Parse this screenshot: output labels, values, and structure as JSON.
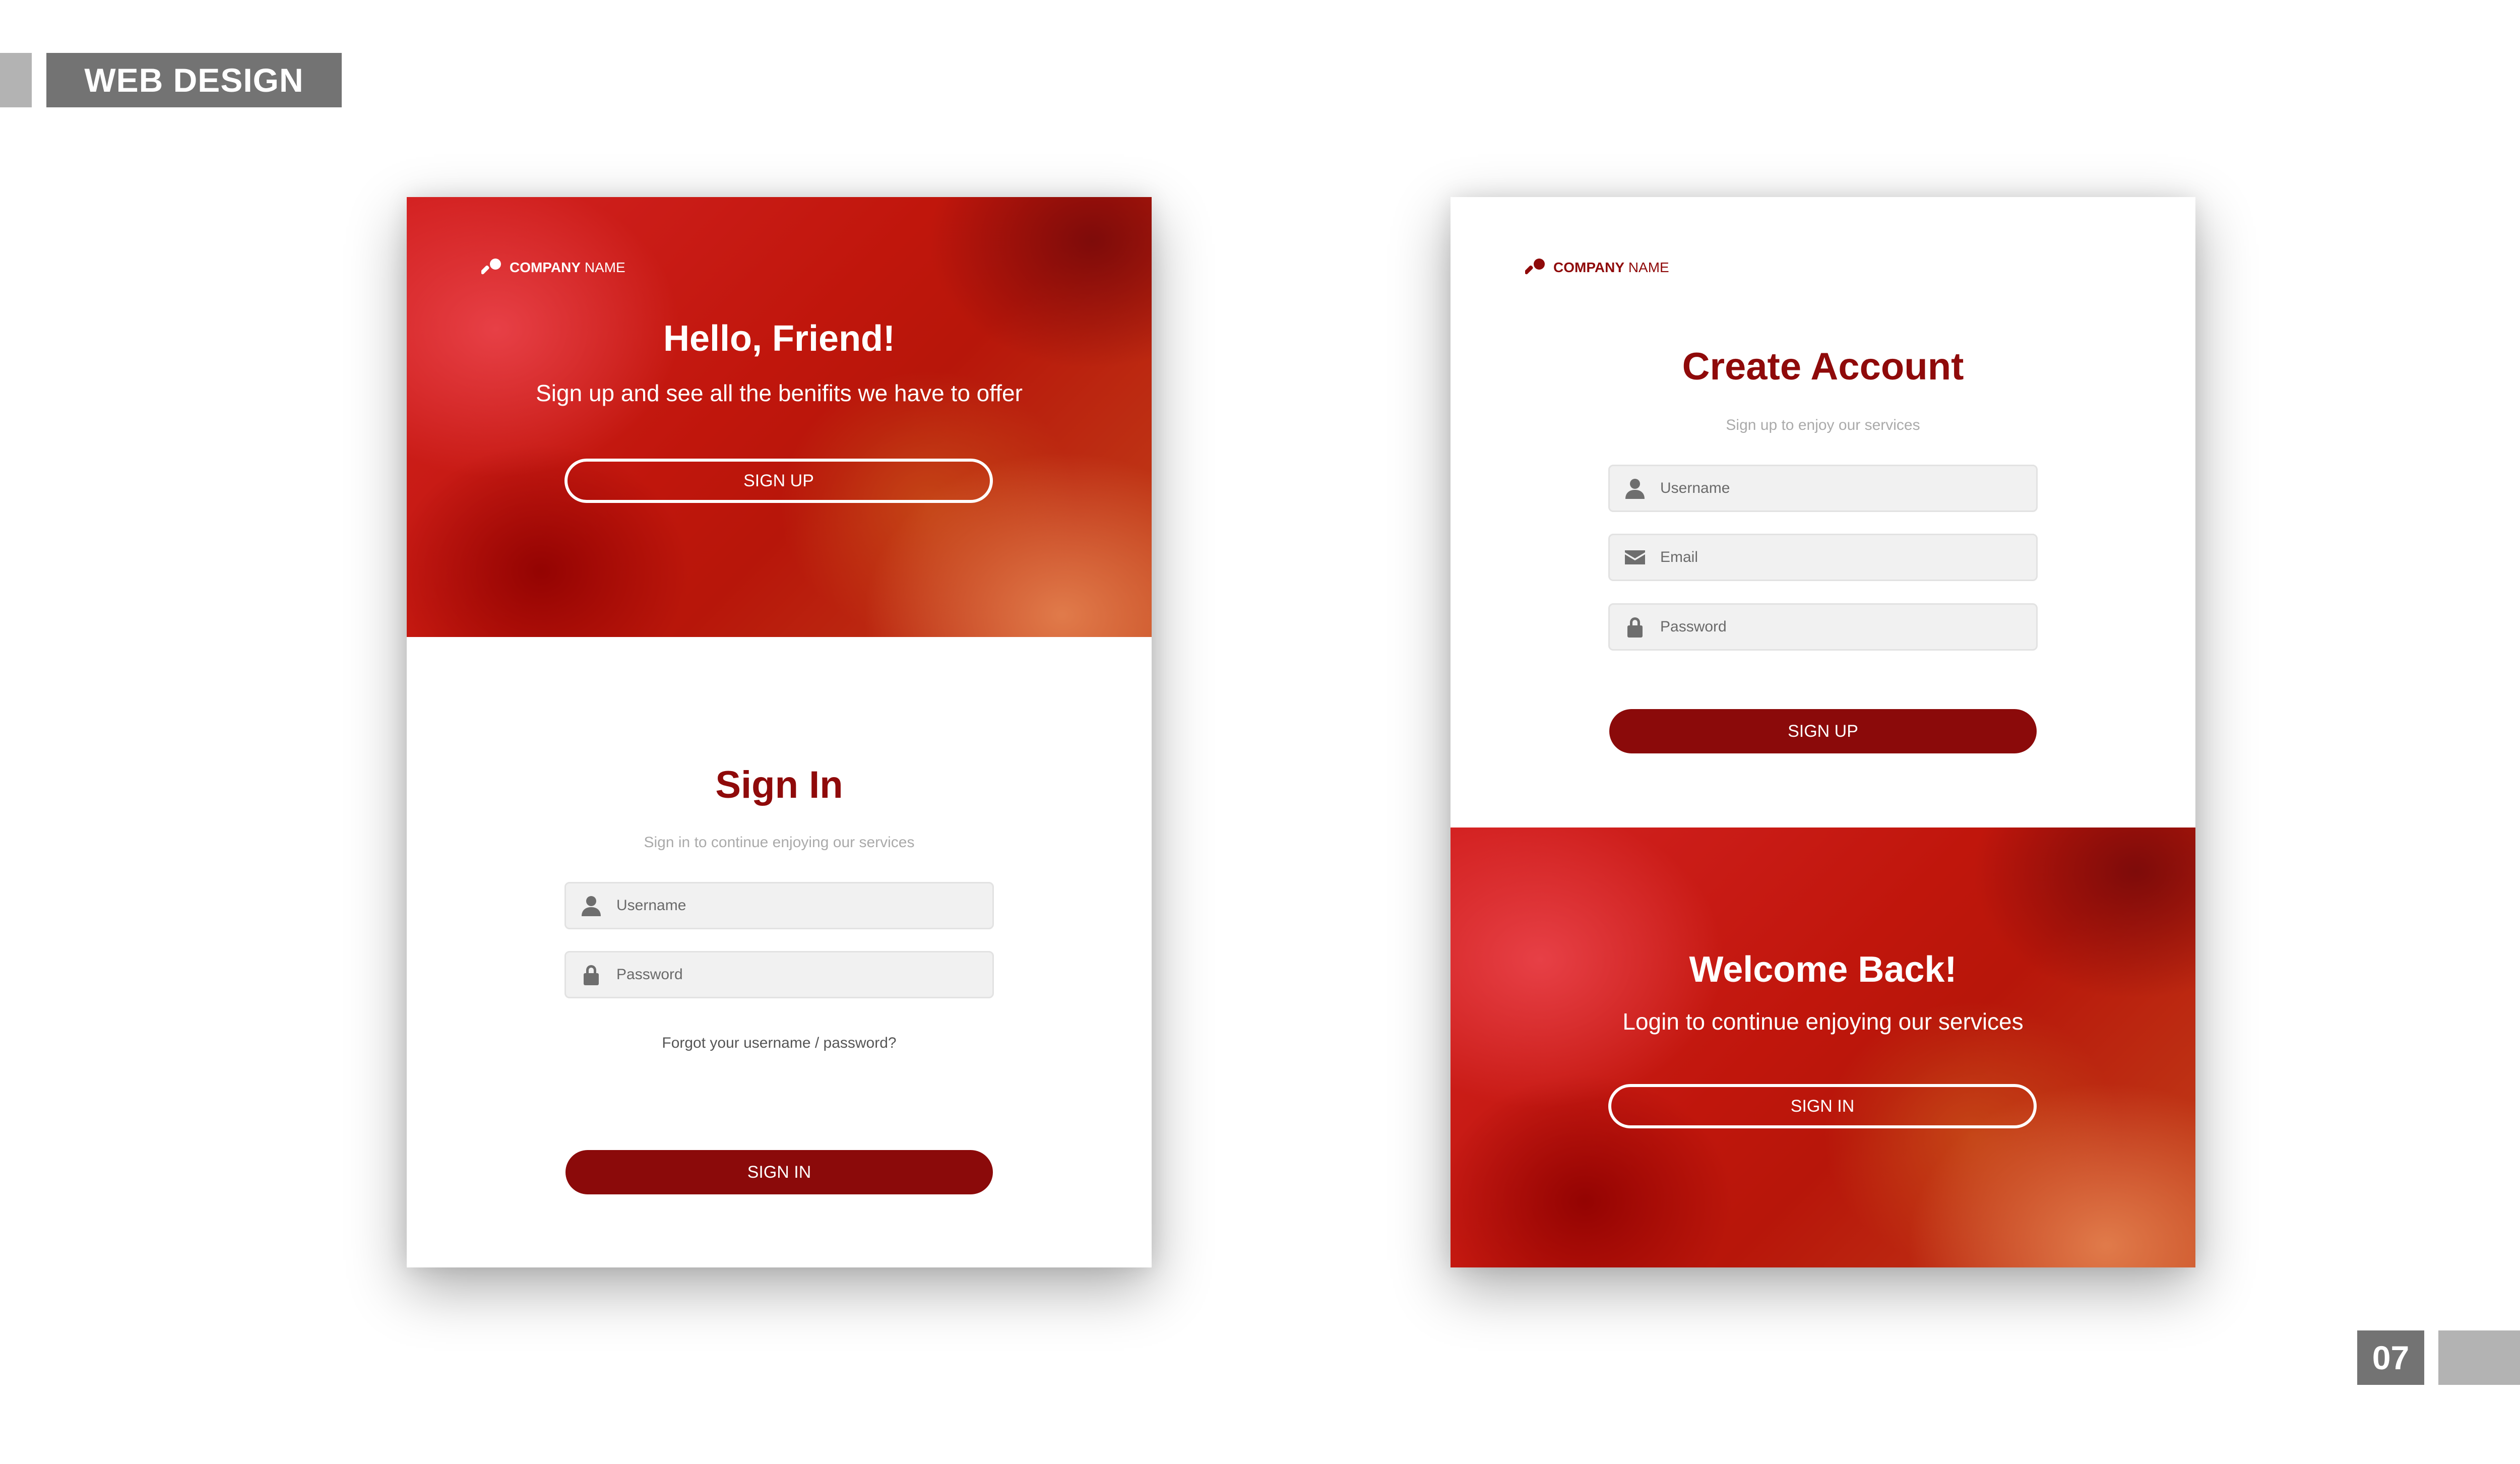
{
  "header": {
    "title": "WEB DESIGN"
  },
  "left_card": {
    "logo": {
      "strong": "COMPANY",
      "light": " NAME"
    },
    "hero": {
      "title": "Hello, Friend!",
      "subtitle": "Sign up and see all the benifits we have to offer",
      "button": "SIGN UP"
    },
    "form": {
      "title": "Sign In",
      "subtitle": "Sign in to continue enjoying our services",
      "username_placeholder": "Username",
      "password_placeholder": "Password",
      "forgot_link": "Forgot your username / password?",
      "submit": "SIGN IN"
    }
  },
  "right_card": {
    "logo": {
      "strong": "COMPANY",
      "light": " NAME"
    },
    "form": {
      "title": "Create Account",
      "subtitle": "Sign up to enjoy our services",
      "username_placeholder": "Username",
      "email_placeholder": "Email",
      "password_placeholder": "Password",
      "submit": "SIGN UP"
    },
    "hero": {
      "title": "Welcome Back!",
      "subtitle": "Login to continue enjoying our services",
      "button": "SIGN IN"
    }
  },
  "footer": {
    "page_number": "07"
  },
  "colors": {
    "brand_red": "#8b0a0a",
    "header_grey": "#737373",
    "accent_grey": "#b3b3b3"
  }
}
